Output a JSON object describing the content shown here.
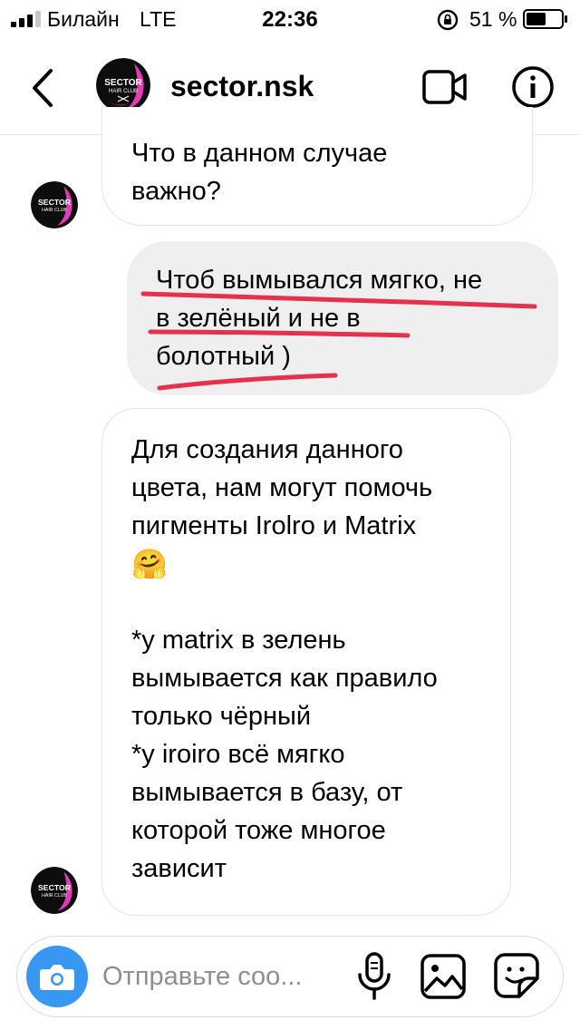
{
  "status_bar": {
    "carrier": "Билайн",
    "network": "LTE",
    "time": "22:36",
    "battery": "51 %"
  },
  "header": {
    "title": "sector.nsk",
    "avatar_logo_line1": "SECTOR",
    "avatar_logo_line2": "HAIR CLUB",
    "icons": {
      "back": "chevron-left-icon",
      "video": "video-camera-icon",
      "info": "info-icon"
    }
  },
  "messages": [
    {
      "from": "sector.nsk",
      "text": "Что в данном случае\nважно?"
    },
    {
      "from": "me",
      "text": "Чтоб вымывался мягко, не\nв зелёный и не в\nболотный )",
      "highlight_color": "#e5304e"
    },
    {
      "from": "sector.nsk",
      "text": "Для создания данного\nцвета, нам могут помочь\nпигменты Irolro и Matrix",
      "emoji": "🤗",
      "text2": "*у matrix в зелень\nвымывается как правило\nтолько чёрный\n*у iroiro всё мягко\nвымывается в базу, от\nкоторой тоже многое\nзависит"
    }
  ],
  "composer": {
    "placeholder": "Отправьте соо...",
    "accent_color": "#3897f0",
    "icons": {
      "camera": "camera-icon",
      "mic": "microphone-icon",
      "gallery": "gallery-icon",
      "sticker": "sticker-icon"
    }
  }
}
